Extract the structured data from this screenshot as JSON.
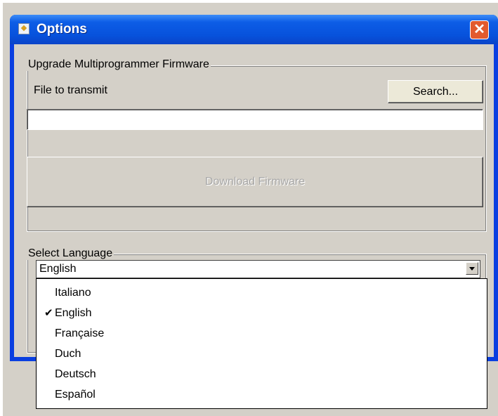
{
  "window": {
    "title": "Options",
    "close_label": "✕"
  },
  "firmware_group": {
    "legend": "Upgrade Multiprogrammer Firmware",
    "file_label": "File to transmit",
    "search_button": "Search...",
    "file_value": "",
    "download_button": "Download Firmware"
  },
  "language_group": {
    "legend": "Select Language",
    "selected": "English",
    "options": [
      {
        "label": "Italiano",
        "checked": false
      },
      {
        "label": "English",
        "checked": true
      },
      {
        "label": "Française",
        "checked": false
      },
      {
        "label": "Duch",
        "checked": false
      },
      {
        "label": "Deutsch",
        "checked": false
      },
      {
        "label": "Español",
        "checked": false
      }
    ]
  },
  "icons": {
    "check": "✔"
  }
}
